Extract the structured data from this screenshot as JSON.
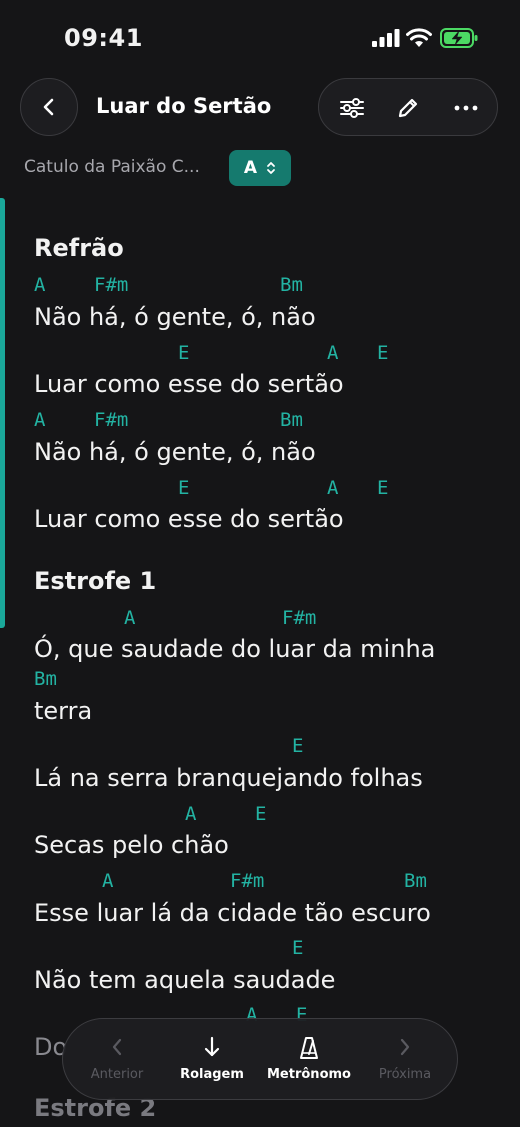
{
  "status": {
    "time": "09:41"
  },
  "header": {
    "title": "Luar do Sertão"
  },
  "meta": {
    "artist": "Catulo da Paixão C...",
    "key": "A"
  },
  "sheet": {
    "sections": [
      {
        "name": "Refrão"
      },
      {
        "name": "Estrofe 1"
      },
      {
        "name": "Estrofe 2"
      }
    ],
    "lines": [
      {
        "chords": [
          "A",
          "F#m",
          "Bm"
        ],
        "lyric": "Não há, ó gente, ó, não"
      },
      {
        "chords": [
          "E",
          "A",
          "E"
        ],
        "lyric": "Luar como esse do sertão"
      },
      {
        "chords": [
          "A",
          "F#m",
          "Bm"
        ],
        "lyric": "Não há, ó gente, ó, não"
      },
      {
        "chords": [
          "E",
          "A",
          "E"
        ],
        "lyric": "Luar como esse do sertão"
      },
      {
        "chords": [
          "A",
          "F#m"
        ],
        "lyric": "Ó, que saudade do luar da minha"
      },
      {
        "chords": [
          "Bm"
        ],
        "lyric": "terra"
      },
      {
        "chords": [
          "E"
        ],
        "lyric": "Lá na serra branquejando folhas"
      },
      {
        "chords": [
          "A",
          "E"
        ],
        "lyric": "Secas pelo chão"
      },
      {
        "chords": [
          "A",
          "F#m",
          "Bm"
        ],
        "lyric": "Esse luar lá da cidade tão escuro"
      },
      {
        "chords": [
          "E"
        ],
        "lyric": "Não tem aquela saudade"
      },
      {
        "chords": [
          "A",
          "E"
        ],
        "lyric": "Do"
      }
    ]
  },
  "toolbar": {
    "previous": "Anterior",
    "scroll": "Rolagem",
    "metronome": "Metrônomo",
    "next": "Próxima"
  },
  "colors": {
    "accent": "#1aa89a",
    "chord": "#23b3a3",
    "background": "#151517"
  }
}
